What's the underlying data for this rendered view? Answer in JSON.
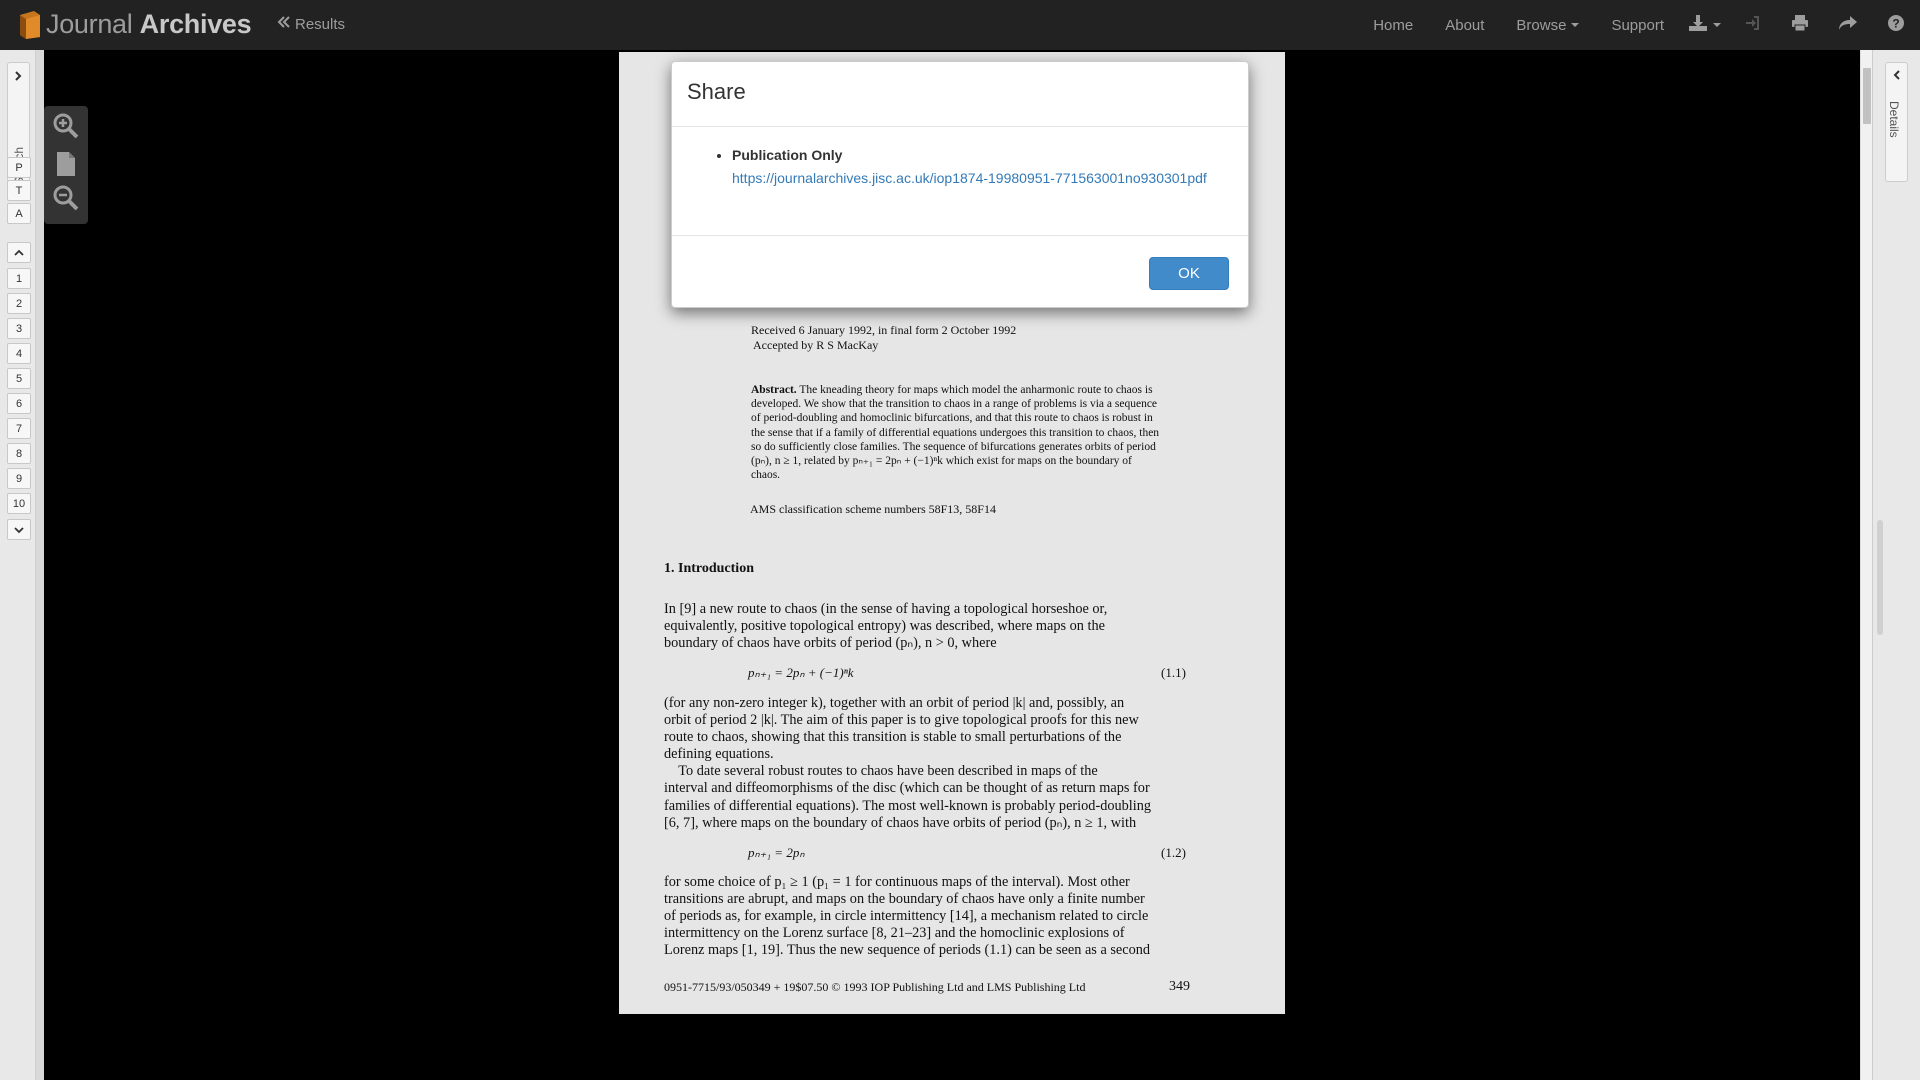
{
  "app": {
    "brand_light": "Journal",
    "brand_bold": "Archives",
    "results_label": "Results"
  },
  "nav": {
    "items": [
      "Home",
      "About",
      "Browse",
      "Support"
    ],
    "icons": [
      "download-icon",
      "sign-in-icon",
      "print-icon",
      "share-icon",
      "help-icon"
    ]
  },
  "left_sidebar": {
    "search_label": "Search",
    "modes": [
      "P",
      "T",
      "A"
    ],
    "pages": [
      "1",
      "2",
      "3",
      "4",
      "5",
      "6",
      "7",
      "8",
      "9",
      "10"
    ]
  },
  "right_sidebar": {
    "details_label": "Details"
  },
  "modal": {
    "title": "Share",
    "item_label": "Publication Only",
    "link": "https://journalarchives.jisc.ac.uk/iop1874-19980951-771563001no930301pdf",
    "ok_label": "OK"
  },
  "document": {
    "received": "Received 6 January 1992, in final form 2 October 1992",
    "accepted": "Accepted by R S MacKay",
    "abstract_label": "Abstract.",
    "abstract_lines": [
      "The kneading theory for maps which model the anharmonic route to chaos is",
      "developed. We show that the transition to chaos in a range of problems is via a sequence",
      "of period-doubling and homoclinic bifurcations, and that this route to chaos is robust in",
      "the sense that if a family of differential equations undergoes this transition to chaos, then",
      "so do sufficiently close families. The sequence of bifurcations generates orbits of period",
      "(pₙ), n ≥ 1, related by pₙ₊₁ = 2pₙ + (−1)ⁿk which exist for maps on the boundary of",
      "chaos."
    ],
    "ams": "AMS classification scheme numbers 58F13, 58F14",
    "section_heading": "1.  Introduction",
    "para1": [
      "In [9] a new route to chaos (in the sense of having a topological horseshoe or,",
      "equivalently, positive topological entropy) was described, where maps on the",
      "boundary of chaos have orbits of period (pₙ), n > 0, where"
    ],
    "eq1": "pₙ₊₁ = 2pₙ + (−1)ⁿk",
    "eq1_num": "(1.1)",
    "para2": [
      "(for any non-zero integer k), together with an orbit of period |k| and, possibly, an",
      "orbit of period 2 |k|. The aim of this paper is to give topological proofs for this new",
      "route to chaos, showing that this transition is stable to small perturbations of the",
      "defining equations.",
      "    To date several robust routes to chaos have been described in maps of the",
      "interval and diffeomorphisms of the disc (which can be thought of as return maps for",
      "families of differential equations). The most well-known is probably period-doubling",
      "[6, 7], where maps on the boundary of chaos have orbits of period (pₙ), n ≥ 1, with"
    ],
    "eq2": "pₙ₊₁ = 2pₙ",
    "eq2_num": "(1.2)",
    "para3": [
      "for some choice of p₁ ≥ 1 (p₁ = 1 for continuous maps of the interval). Most other",
      "transitions are abrupt, and maps on the boundary of chaos have only a finite number",
      "of periods as, for example, in circle intermittency [14], a mechanism related to circle",
      "intermittency on the Lorenz surface [8, 21–23] and the homoclinic explosions of",
      "Lorenz maps [1, 19]. Thus the new sequence of periods (1.1) can be seen as a second"
    ],
    "footer_left": "0951-7715/93/050349 + 19$07.50 © 1993 IOP Publishing Ltd and LMS Publishing Ltd",
    "page_number": "349"
  },
  "colors": {
    "navbar": "#222222",
    "primary_button": "#428bca",
    "link": "#337ab7"
  }
}
